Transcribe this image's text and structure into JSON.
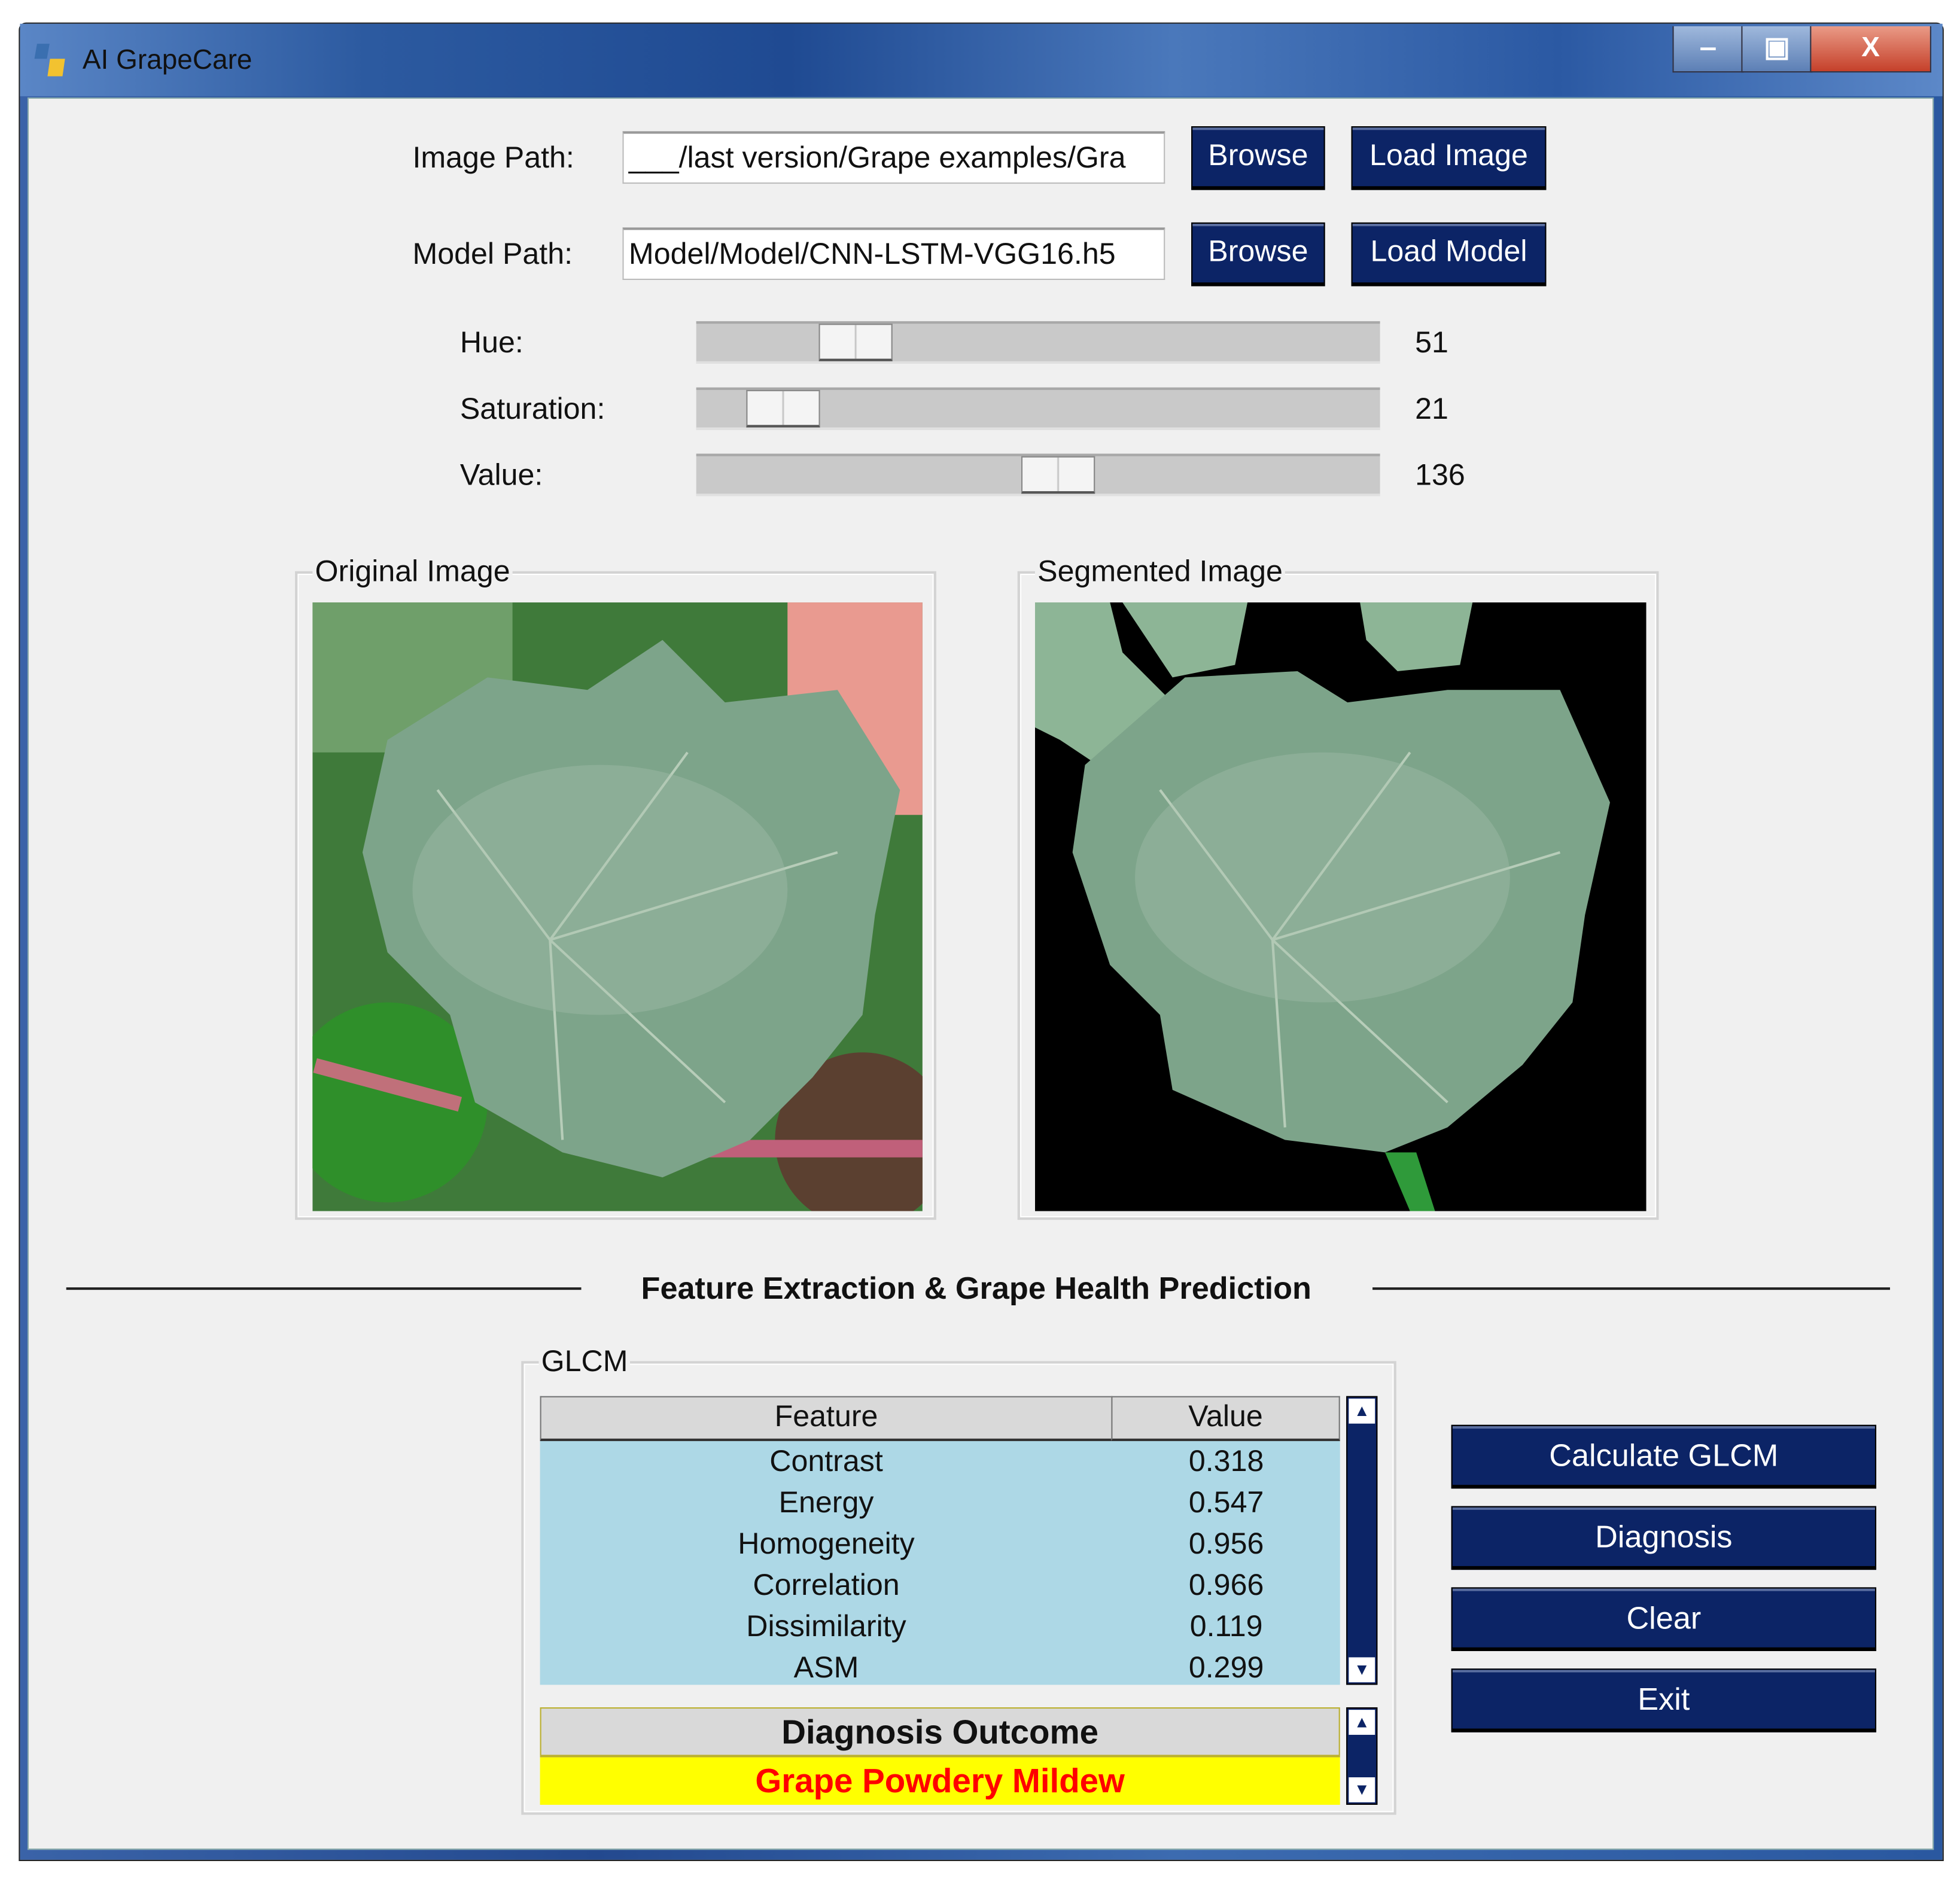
{
  "window": {
    "title": "AI GrapeCare",
    "minimize": "‒",
    "maximize": "▣",
    "close": "X"
  },
  "image_path": {
    "label": "Image Path:",
    "value": "___/last version/Grape examples/Gra",
    "browse": "Browse",
    "load": "Load Image"
  },
  "model_path": {
    "label": "Model Path:",
    "value": "Model/Model/CNN-LSTM-VGG16.h5",
    "browse": "Browse",
    "load": "Load Model"
  },
  "sliders": [
    {
      "label": "Hue:",
      "value": 51,
      "max": 255
    },
    {
      "label": "Saturation:",
      "value": 21,
      "max": 255
    },
    {
      "label": "Value:",
      "value": 136,
      "max": 255
    }
  ],
  "original": {
    "title": "Original Image"
  },
  "segmented": {
    "title": "Segmented Image"
  },
  "section_title": "Feature Extraction & Grape Health Prediction",
  "glcm": {
    "title": "GLCM",
    "headers": [
      "Feature",
      "Value"
    ],
    "rows": [
      {
        "feature": "Contrast",
        "value": "0.318"
      },
      {
        "feature": "Energy",
        "value": "0.547"
      },
      {
        "feature": "Homogeneity",
        "value": "0.956"
      },
      {
        "feature": "Correlation",
        "value": "0.966"
      },
      {
        "feature": "Dissimilarity",
        "value": "0.119"
      },
      {
        "feature": "ASM",
        "value": "0.299"
      }
    ]
  },
  "outcome": {
    "header": "Diagnosis Outcome",
    "value": "Grape Powdery Mildew",
    "color": "#ff0000",
    "bg": "#ffff00"
  },
  "actions": {
    "calculate": "Calculate GLCM",
    "diagnosis": "Diagnosis",
    "clear": "Clear",
    "exit": "Exit"
  },
  "colors": {
    "button": "#0c2466",
    "table_bg": "#add8e6"
  }
}
